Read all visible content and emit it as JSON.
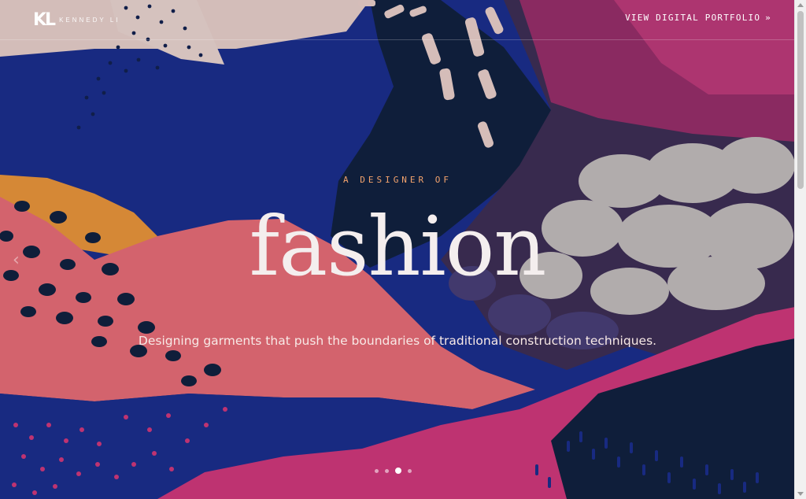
{
  "header": {
    "logo_mark": "KL",
    "logo_name": "KENNEDY LI",
    "portfolio_link": "VIEW DIGITAL PORTFOLIO",
    "portfolio_arrow": "»"
  },
  "hero": {
    "eyebrow": "A DESIGNER OF",
    "headline": "fashion",
    "subline": "Designing garments that push the boundaries of traditional construction techniques.",
    "prev_arrow": "‹"
  },
  "carousel": {
    "slide_count": 4,
    "active_slide": 3
  },
  "colors": {
    "navy": "#1b2f8f",
    "dark_teal": "#10223e",
    "coral": "#f07078",
    "pink": "#d83a7d",
    "orange": "#f29a3a",
    "blush": "#f2d6cf",
    "eyebrow": "#f3a36d"
  }
}
